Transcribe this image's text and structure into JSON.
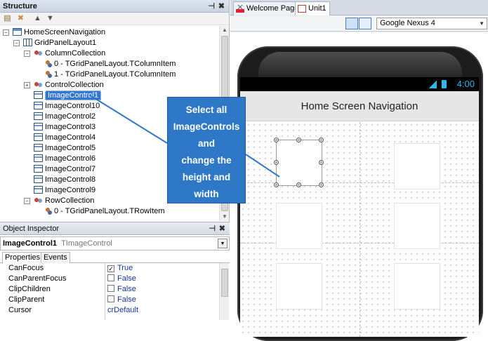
{
  "structure": {
    "title": "Structure",
    "pin": "📌",
    "close": "✖",
    "tree": [
      {
        "label": "HomeScreenNavigation",
        "level": 0,
        "icon": "form-icon",
        "expander": "-"
      },
      {
        "label": "GridPanelLayout1",
        "level": 1,
        "icon": "grid-icon",
        "expander": "-"
      },
      {
        "label": "ColumnCollection",
        "level": 2,
        "icon": "collection-icon",
        "expander": "-"
      },
      {
        "label": "0 - TGridPanelLayout.TColumnItem",
        "level": 3,
        "icon": "item-icon",
        "expander": ""
      },
      {
        "label": "1 - TGridPanelLayout.TColumnItem",
        "level": 3,
        "icon": "item-icon",
        "expander": ""
      },
      {
        "label": "ControlCollection",
        "level": 2,
        "icon": "collection-icon",
        "expander": "+"
      },
      {
        "label": "ImageControl1",
        "level": 2,
        "icon": "image-icon",
        "expander": "",
        "selected": true
      },
      {
        "label": "ImageControl10",
        "level": 2,
        "icon": "image-icon",
        "expander": ""
      },
      {
        "label": "ImageControl2",
        "level": 2,
        "icon": "image-icon",
        "expander": ""
      },
      {
        "label": "ImageControl3",
        "level": 2,
        "icon": "image-icon",
        "expander": ""
      },
      {
        "label": "ImageControl4",
        "level": 2,
        "icon": "image-icon",
        "expander": ""
      },
      {
        "label": "ImageControl5",
        "level": 2,
        "icon": "image-icon",
        "expander": ""
      },
      {
        "label": "ImageControl6",
        "level": 2,
        "icon": "image-icon",
        "expander": ""
      },
      {
        "label": "ImageControl7",
        "level": 2,
        "icon": "image-icon",
        "expander": ""
      },
      {
        "label": "ImageControl8",
        "level": 2,
        "icon": "image-icon",
        "expander": ""
      },
      {
        "label": "ImageControl9",
        "level": 2,
        "icon": "image-icon",
        "expander": ""
      },
      {
        "label": "RowCollection",
        "level": 2,
        "icon": "collection-icon",
        "expander": "-"
      },
      {
        "label": "0 - TGridPanelLayout.TRowItem",
        "level": 3,
        "icon": "item-icon",
        "expander": ""
      }
    ]
  },
  "inspector": {
    "title": "Object Inspector",
    "pin": "📌",
    "close": "✖",
    "selected_name": "ImageControl1",
    "selected_type": "TImageControl",
    "tabs": [
      "Properties",
      "Events"
    ],
    "properties": [
      {
        "name": "CanFocus",
        "value": "True",
        "checkbox": true,
        "checked": true
      },
      {
        "name": "CanParentFocus",
        "value": "False",
        "checkbox": true,
        "checked": false
      },
      {
        "name": "ClipChildren",
        "value": "False",
        "checkbox": true,
        "checked": false
      },
      {
        "name": "ClipParent",
        "value": "False",
        "checkbox": true,
        "checked": false
      },
      {
        "name": "Cursor",
        "value": "crDefault",
        "checkbox": false,
        "checked": false
      }
    ]
  },
  "editor": {
    "tabs": [
      {
        "label": "Welcome Page",
        "icon": "home-icon",
        "active": false
      },
      {
        "label": "Unit1",
        "icon": "unit-icon",
        "active": true
      }
    ],
    "device": "Google Nexus 4"
  },
  "phone": {
    "time": "4:00",
    "app_title": "Home Screen Navigation"
  },
  "callout": {
    "lines": [
      "Select all",
      "ImageControls",
      "and",
      "change the",
      "height and",
      "width"
    ]
  },
  "colors": {
    "selection": "#3275d6",
    "callout": "#2f78c8",
    "status_accent": "#33b5e5"
  }
}
